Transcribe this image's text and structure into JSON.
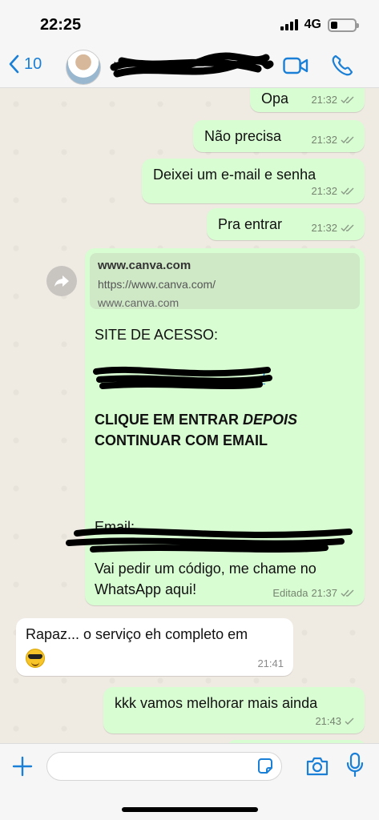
{
  "status_bar": {
    "time": "22:25",
    "network": "4G"
  },
  "header": {
    "back_count": "10",
    "contact_name": "+"
  },
  "messages": [
    {
      "text": "Opa",
      "time": "21:32"
    },
    {
      "text": "Não precisa",
      "time": "21:32"
    },
    {
      "text": "Deixei um e-mail e senha",
      "time": "21:32"
    },
    {
      "text": "Pra entrar",
      "time": "21:32"
    },
    {
      "link_preview": {
        "title": "www.canva.com",
        "url": "https://www.canva.com/",
        "domain": "www.canva.com"
      },
      "site_label": "SITE DE ACESSO:",
      "link_tail": "/",
      "instruction_line1_a": "CLIQUE EM ENTRAR ",
      "instruction_line1_b": "DEPOIS",
      "instruction_line2": "CONTINUAR COM EMAIL",
      "email_label": "Email:",
      "code_line1": "Vai pedir um código, me chame no",
      "code_line2": "WhatsApp aqui!",
      "edited": "Editada",
      "time": "21:37"
    },
    {
      "text": "Rapaz... o serviço eh completo em",
      "time": "21:41",
      "emoji": "sunglasses-emoji"
    },
    {
      "text": "kkk vamos melhorar mais ainda",
      "time": "21:43"
    }
  ],
  "input": {
    "placeholder": ""
  },
  "colors": {
    "outgoing_bubble": "#d9fdd3",
    "incoming_bubble": "#ffffff",
    "accent": "#1a7fd6",
    "chat_bg": "#efeae2"
  }
}
